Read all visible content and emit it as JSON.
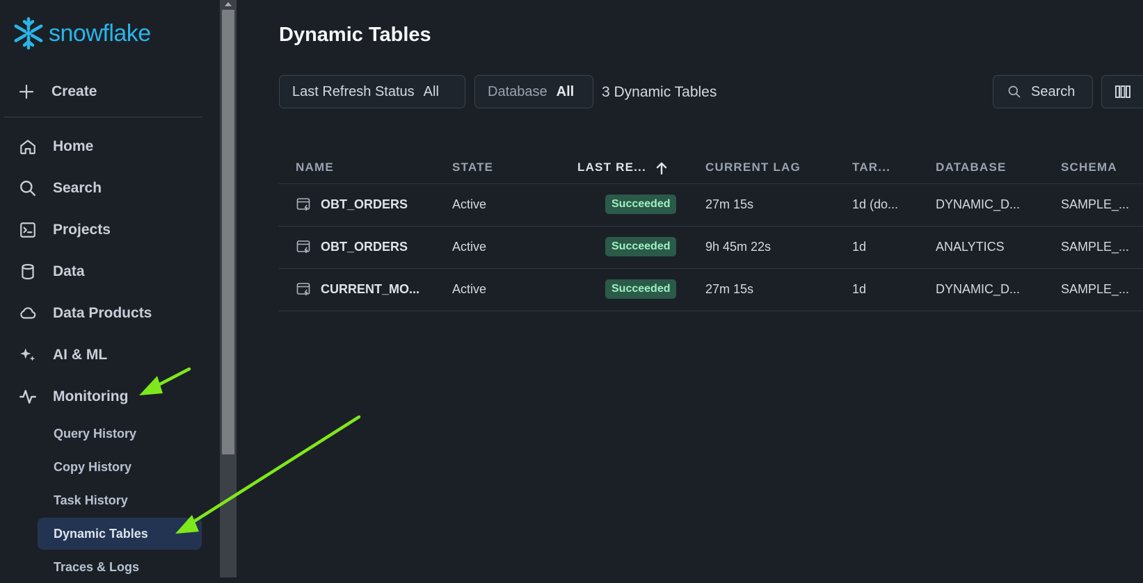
{
  "brand": {
    "logo_text": "snowflake",
    "color": "#29b5e8"
  },
  "sidebar": {
    "create_label": "Create",
    "items": [
      {
        "label": "Home",
        "icon": "home-icon"
      },
      {
        "label": "Search",
        "icon": "search-icon"
      },
      {
        "label": "Projects",
        "icon": "terminal-icon"
      },
      {
        "label": "Data",
        "icon": "database-icon"
      },
      {
        "label": "Data Products",
        "icon": "cloud-icon"
      },
      {
        "label": "AI & ML",
        "icon": "sparkle-icon"
      },
      {
        "label": "Monitoring",
        "icon": "activity-icon"
      }
    ],
    "monitoring_subitems": [
      {
        "label": "Query History"
      },
      {
        "label": "Copy History"
      },
      {
        "label": "Task History"
      },
      {
        "label": "Dynamic Tables",
        "active": true
      },
      {
        "label": "Traces & Logs"
      }
    ]
  },
  "main": {
    "title": "Dynamic Tables",
    "filters": [
      {
        "label": "Last Refresh Status",
        "value": "All"
      },
      {
        "label": "Database",
        "value": "All"
      }
    ],
    "count_text": "3 Dynamic Tables",
    "search_label": "Search",
    "columns_icon": "columns-icon"
  },
  "table": {
    "headers": [
      "NAME",
      "STATE",
      "LAST RE...",
      "CURRENT LAG",
      "TAR...",
      "DATABASE",
      "SCHEMA"
    ],
    "sort_indicator": "arrow-up-icon",
    "rows": [
      {
        "name": "OBT_ORDERS",
        "state": "Active",
        "status": "Succeeded",
        "lag": "27m 15s",
        "target": "1d (do...",
        "database": "DYNAMIC_D...",
        "schema": "SAMPLE_..."
      },
      {
        "name": "OBT_ORDERS",
        "state": "Active",
        "status": "Succeeded",
        "lag": "9h 45m 22s",
        "target": "1d",
        "database": "ANALYTICS",
        "schema": "SAMPLE_..."
      },
      {
        "name": "CURRENT_MO...",
        "state": "Active",
        "status": "Succeeded",
        "lag": "27m 15s",
        "target": "1d",
        "database": "DYNAMIC_D...",
        "schema": "SAMPLE_..."
      }
    ]
  },
  "colors": {
    "background": "#1b2027",
    "active_nav": "#233452",
    "success_badge_bg": "#2b5a48",
    "success_badge_text": "#9ff0c3",
    "annotation_arrow": "#7ee81c"
  }
}
